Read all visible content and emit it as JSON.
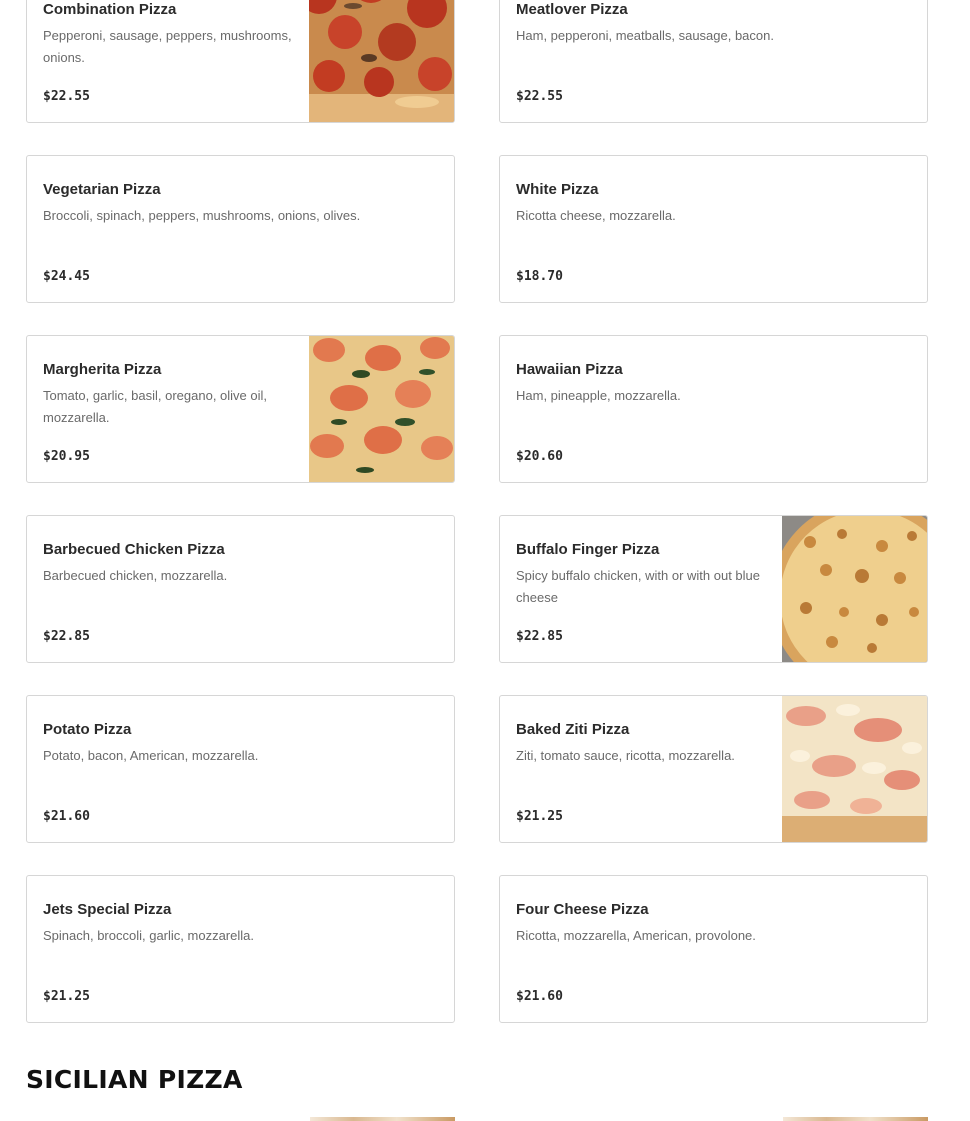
{
  "menu_items": [
    {
      "name": "Combination Pizza",
      "description": "Pepperoni, sausage, peppers, mushrooms, onions.",
      "price": "$22.55",
      "image": "combination-pizza-photo"
    },
    {
      "name": "Meatlover Pizza",
      "description": "Ham, pepperoni, meatballs, sausage, bacon.",
      "price": "$22.55"
    },
    {
      "name": "Vegetarian Pizza",
      "description": "Broccoli, spinach, peppers, mushrooms, onions, olives.",
      "price": "$24.45"
    },
    {
      "name": "White Pizza",
      "description": "Ricotta cheese, mozzarella.",
      "price": "$18.70"
    },
    {
      "name": "Margherita Pizza",
      "description": "Tomato, garlic, basil, oregano, olive oil, mozzarella.",
      "price": "$20.95",
      "image": "margherita-pizza-photo"
    },
    {
      "name": "Hawaiian Pizza",
      "description": "Ham, pineapple, mozzarella.",
      "price": "$20.60"
    },
    {
      "name": "Barbecued Chicken Pizza",
      "description": "Barbecued chicken, mozzarella.",
      "price": "$22.85"
    },
    {
      "name": "Buffalo Finger Pizza",
      "description": "Spicy buffalo chicken, with or with out blue cheese",
      "price": "$22.85",
      "image": "buffalo-finger-pizza-photo"
    },
    {
      "name": "Potato Pizza",
      "description": "Potato, bacon, American, mozzarella.",
      "price": "$21.60"
    },
    {
      "name": "Baked Ziti Pizza",
      "description": "Ziti, tomato sauce, ricotta, mozzarella.",
      "price": "$21.25",
      "image": "baked-ziti-pizza-photo"
    },
    {
      "name": "Jets Special Pizza",
      "description": "Spinach, broccoli, garlic, mozzarella.",
      "price": "$21.25"
    },
    {
      "name": "Four Cheese Pizza",
      "description": "Ricotta, mozzarella, American, provolone.",
      "price": "$21.60"
    }
  ],
  "next_section": {
    "title": "SICILIAN PIZZA"
  }
}
